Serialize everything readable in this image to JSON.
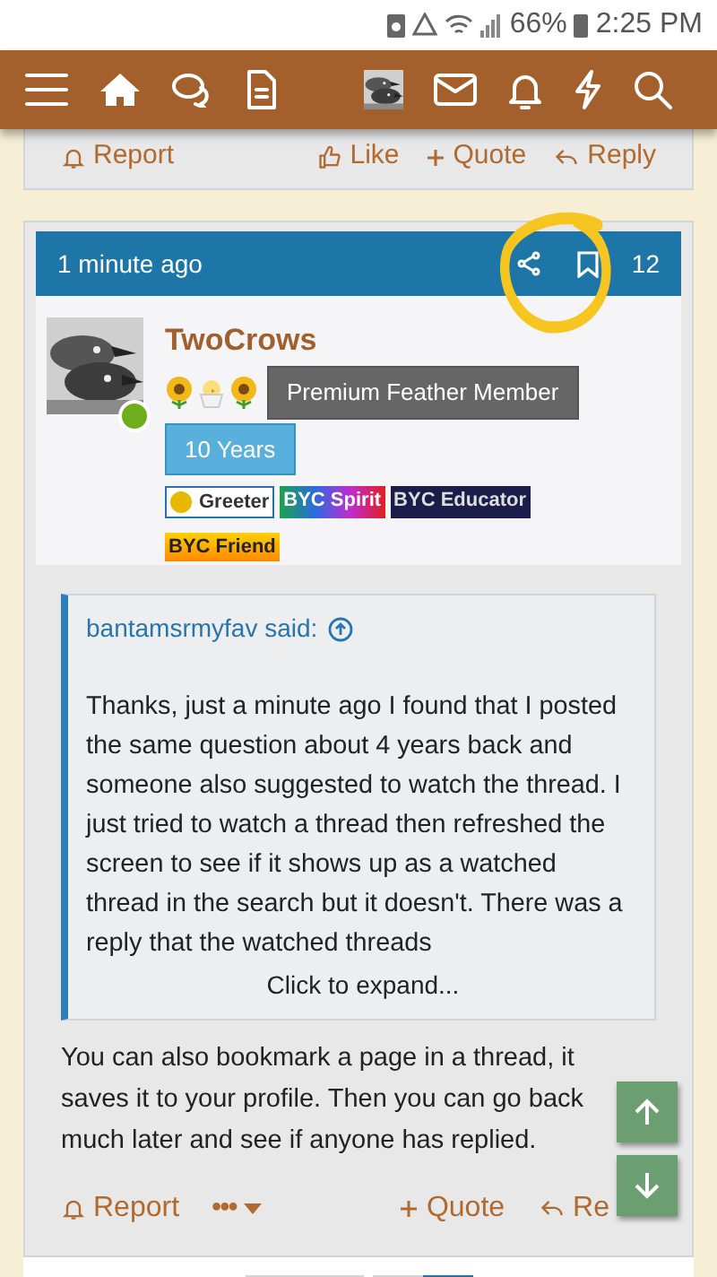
{
  "status_bar": {
    "battery": "66%",
    "time": "2:25 PM"
  },
  "previous_post": {
    "actions": [
      {
        "kind": "report",
        "label": "Report"
      },
      {
        "kind": "like",
        "label": "Like"
      },
      {
        "kind": "quote",
        "label": "Quote"
      },
      {
        "kind": "reply",
        "label": "Reply"
      }
    ]
  },
  "post": {
    "time": "1 minute ago",
    "number": "12",
    "author": "TwoCrows",
    "online": true,
    "user_title": "Premium Feather Member",
    "tenure": "10 Years",
    "badges": [
      {
        "kind": "greeter",
        "label": "Greeter"
      },
      {
        "kind": "spirit",
        "label": "BYC Spirit"
      },
      {
        "kind": "educator",
        "label": "BYC Educator"
      },
      {
        "kind": "friend",
        "label": "BYC Friend"
      }
    ],
    "quote": {
      "author": "bantamsrmyfav said:",
      "text": "Thanks, just a minute ago I found that I posted the same question about 4 years back and someone also suggested to watch the thread. I just tried to watch a thread then refreshed the screen to see if it shows up as a watched thread in the search but it doesn't. There was a reply that the watched threads",
      "expand": "Click to expand..."
    },
    "body": "You can also bookmark a page in a thread, it saves it to your profile. Then you can go back much later and see if anyone has replied.",
    "actions": [
      {
        "kind": "report",
        "label": "Report"
      },
      {
        "kind": "more",
        "label": "•••"
      },
      {
        "kind": "quote",
        "label": "Quote"
      },
      {
        "kind": "reply",
        "label": "Re"
      }
    ]
  }
}
